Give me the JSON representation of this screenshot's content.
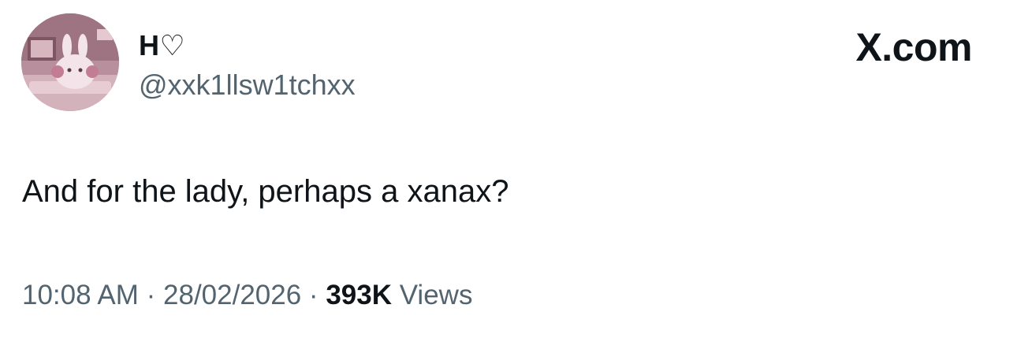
{
  "author": {
    "display_name": "H♡",
    "handle": "@xxk1llsw1tchxx",
    "avatar_description": "avatar"
  },
  "brand": {
    "label": "X.com"
  },
  "tweet": {
    "text": "And for the lady, perhaps a xanax?"
  },
  "meta": {
    "time": "10:08 AM",
    "separator": "·",
    "date": "28/02/2026",
    "views_count": "393K",
    "views_label": "Views"
  },
  "colors": {
    "text_primary": "#0f1419",
    "text_secondary": "#536471",
    "background": "#ffffff",
    "avatar_tint": "#c9a7b1"
  }
}
